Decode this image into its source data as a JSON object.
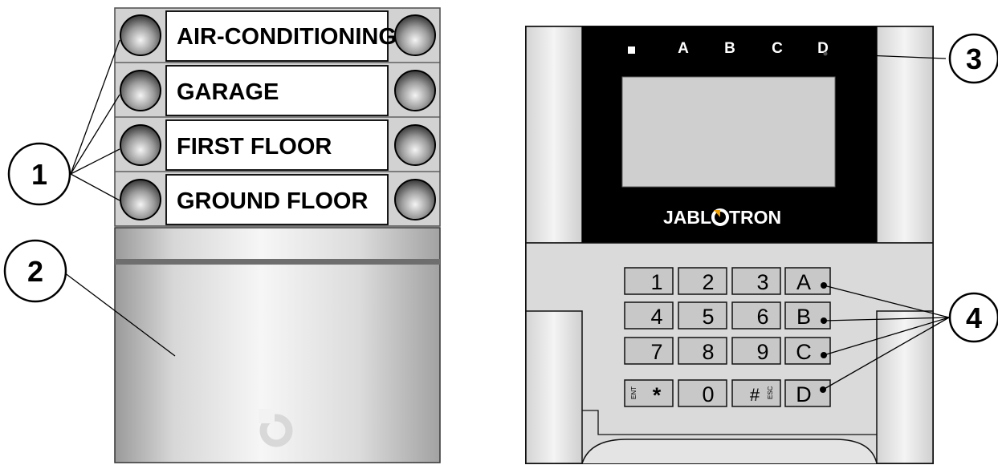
{
  "segment_panel": {
    "labels": [
      "AIR-CONDITIONING",
      "GARAGE",
      "FIRST FLOOR",
      "GROUND FLOOR"
    ],
    "logo_icon": "jablotron-swirl-icon"
  },
  "keypad_unit": {
    "indicators": [
      "A",
      "B",
      "C",
      "D"
    ],
    "brand_prefix": "JABL",
    "brand_suffix": "TRON",
    "brand_logo_icon": "jablotron-o-logo-icon",
    "keys": [
      [
        "1",
        "2",
        "3",
        "A"
      ],
      [
        "4",
        "5",
        "6",
        "B"
      ],
      [
        "7",
        "8",
        "9",
        "C"
      ],
      [
        "*",
        "0",
        "#",
        "D"
      ]
    ],
    "key_small_labels": {
      "star": "ENT",
      "hash": "ESC"
    }
  },
  "callouts": [
    "1",
    "2",
    "3",
    "4"
  ],
  "colors": {
    "accent_logo": "#f2a000",
    "display": "#cfcfcf",
    "panel_dark": "#000000"
  }
}
